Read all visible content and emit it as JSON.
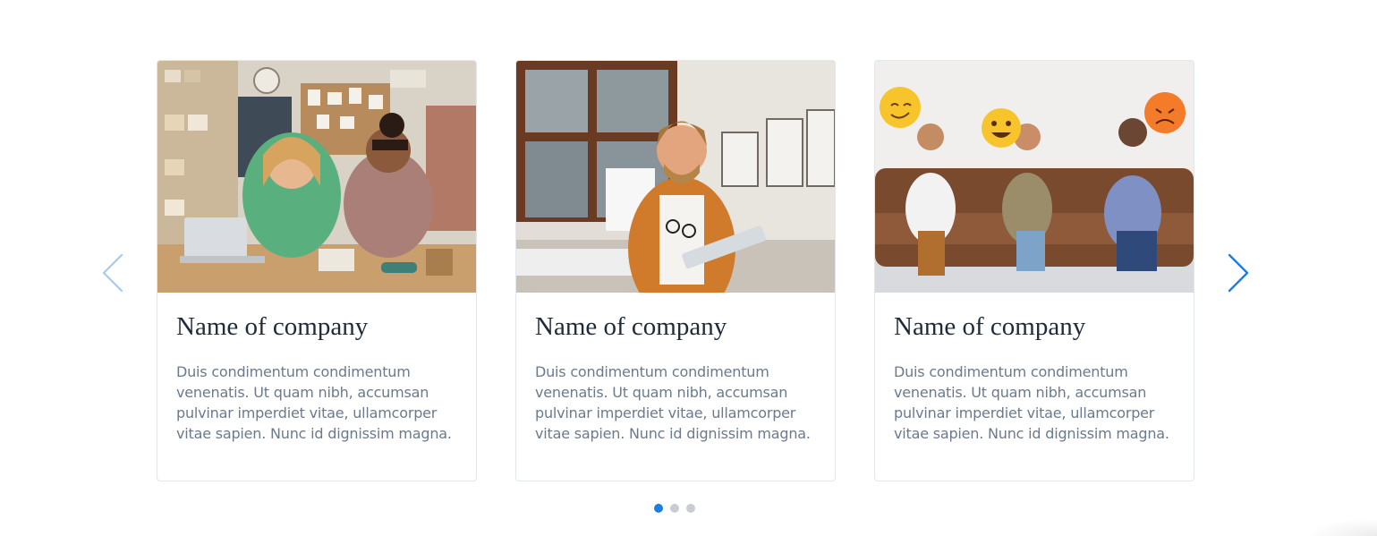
{
  "carousel": {
    "prev_icon": "chevron-left-icon",
    "next_icon": "chevron-right-icon",
    "cards": [
      {
        "title": "Name of company",
        "text": "Duis condimentum condimentum venenatis. Ut quam nibh, accumsan pulvinar imperdiet vitae, ullamcorper vitae sapien. Nunc id dignissim magna."
      },
      {
        "title": "Name of company",
        "text": "Duis condimentum condimentum venenatis. Ut quam nibh, accumsan pulvinar imperdiet vitae, ullamcorper vitae sapien. Nunc id dignissim magna."
      },
      {
        "title": "Name of company",
        "text": "Duis condimentum condimentum venenatis. Ut quam nibh, accumsan pulvinar imperdiet vitae, ullamcorper vitae sapien. Nunc id dignissim magna."
      }
    ],
    "pagination": {
      "count": 3,
      "active_index": 0
    }
  },
  "colors": {
    "accent": "#1e7ee0",
    "title": "#1f2a3a",
    "body_text": "#6b7a8c",
    "dot_inactive": "#c9cdd2",
    "card_border": "#e3e6ea"
  }
}
